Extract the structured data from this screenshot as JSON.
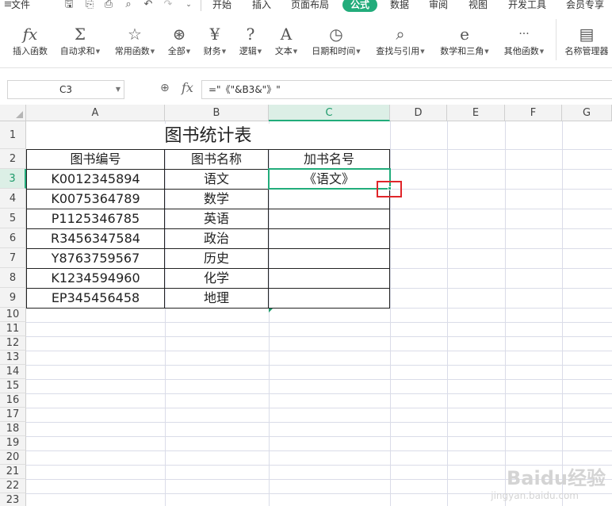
{
  "menu": {
    "file": "文件",
    "tabs": [
      "开始",
      "插入",
      "页面布局",
      "公式",
      "数据",
      "审阅",
      "视图",
      "开发工具",
      "会员专享"
    ],
    "active_tab": "公式",
    "accent": "#22ac7b"
  },
  "ribbon": {
    "buttons": [
      {
        "icon": "fx",
        "icon_name": "insert-function-icon",
        "label": "插入函数",
        "dropdown": false
      },
      {
        "icon": "Σ",
        "icon_name": "sum-icon",
        "label": "自动求和",
        "dropdown": true
      },
      {
        "icon": "☆",
        "icon_name": "star-icon",
        "label": "常用函数",
        "dropdown": true
      },
      {
        "icon": "⊛",
        "icon_name": "all-functions-icon",
        "label": "全部",
        "dropdown": true
      },
      {
        "icon": "¥",
        "icon_name": "finance-icon",
        "label": "财务",
        "dropdown": true
      },
      {
        "icon": "?",
        "icon_name": "logic-icon",
        "label": "逻辑",
        "dropdown": true
      },
      {
        "icon": "A",
        "icon_name": "text-icon",
        "label": "文本",
        "dropdown": true
      },
      {
        "icon": "◷",
        "icon_name": "datetime-icon",
        "label": "日期和时间",
        "dropdown": true
      },
      {
        "icon": "⌕",
        "icon_name": "lookup-icon",
        "label": "查找与引用",
        "dropdown": true
      },
      {
        "icon": "e",
        "icon_name": "math-icon",
        "label": "数学和三角",
        "dropdown": true
      },
      {
        "icon": "···",
        "icon_name": "more-functions-icon",
        "label": "其他函数",
        "dropdown": true
      },
      {
        "icon": "▤",
        "icon_name": "name-manager-icon",
        "label": "名称管理器",
        "dropdown": false
      }
    ]
  },
  "formula_bar": {
    "name_box": "C3",
    "fx": "fx",
    "formula": "=\"《\"&B3&\"》\""
  },
  "sheet": {
    "columns": [
      "A",
      "B",
      "C",
      "D",
      "E",
      "F",
      "G"
    ],
    "selected_column": "C",
    "rows": [
      "1",
      "2",
      "3",
      "4",
      "5",
      "6",
      "7",
      "8",
      "9",
      "10",
      "11",
      "12",
      "13",
      "14",
      "15",
      "16",
      "17",
      "18",
      "19",
      "20",
      "21",
      "22",
      "23"
    ],
    "selected_row": "3",
    "title": "图书统计表",
    "headers": [
      "图书编号",
      "图书名称",
      "加书名号"
    ],
    "table": [
      [
        "K0012345894",
        "语文",
        "《语文》"
      ],
      [
        "K0075364789",
        "数学",
        ""
      ],
      [
        "P1125346785",
        "英语",
        ""
      ],
      [
        "R3456347584",
        "政治",
        ""
      ],
      [
        "Y8763759567",
        "历史",
        ""
      ],
      [
        "K1234594960",
        "化学",
        ""
      ],
      [
        "EP345456458",
        "地理",
        ""
      ]
    ]
  },
  "watermark": {
    "brand": "Baidu经验",
    "url": "jingyan.baidu.com"
  }
}
